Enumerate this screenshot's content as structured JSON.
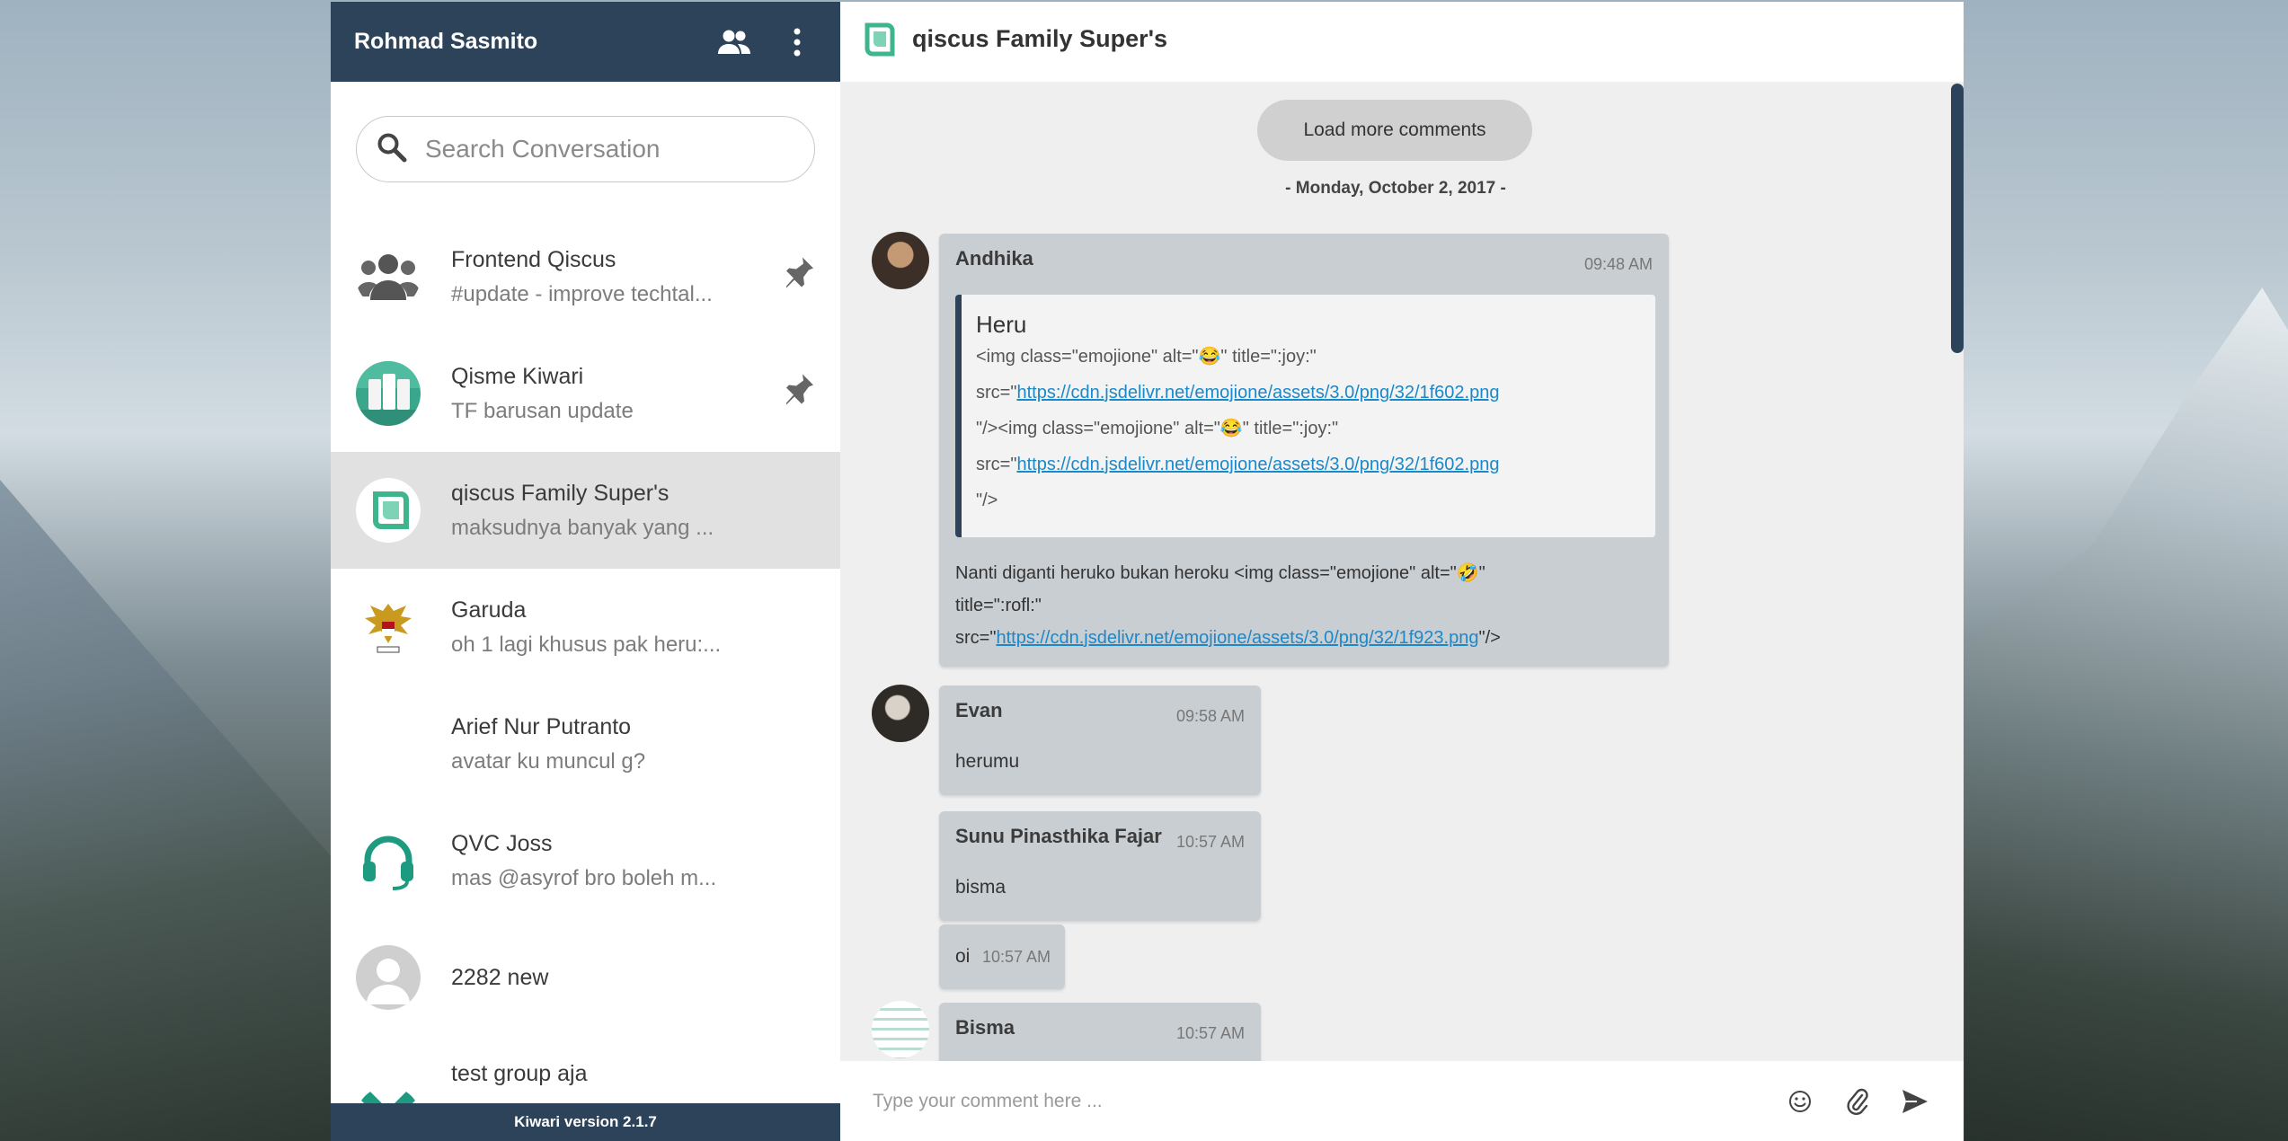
{
  "app": {
    "version": "Kiwari version 2.1.7"
  },
  "sidebar": {
    "user_name": "Rohmad Sasmito",
    "search_placeholder": "Search Conversation",
    "conversations": [
      {
        "name": "Frontend Qiscus",
        "last": "#update - improve techtal...",
        "pinned": true,
        "avatar": "group-icon"
      },
      {
        "name": "Qisme Kiwari",
        "last": "TF barusan update",
        "pinned": true,
        "avatar": "app-screens-avatar"
      },
      {
        "name": "qiscus Family Super's",
        "last": "maksudnya banyak yang ...",
        "pinned": false,
        "active": true,
        "avatar": "qiscus-logo"
      },
      {
        "name": "Garuda",
        "last": "oh 1 lagi khusus pak heru:...",
        "pinned": false,
        "avatar": "garuda-emblem"
      },
      {
        "name": "Arief Nur Putranto",
        "last": "avatar ku muncul g?",
        "pinned": false,
        "avatar": "none"
      },
      {
        "name": "QVC Joss",
        "last": "mas @asyrof bro boleh m...",
        "pinned": false,
        "avatar": "headset-icon"
      },
      {
        "name": "2282 new",
        "last": "",
        "pinned": false,
        "avatar": "default-person-icon"
      },
      {
        "name": "test group aja",
        "last": "",
        "pinned": false,
        "avatar": "x-logo"
      }
    ]
  },
  "chat": {
    "title": "qiscus Family Super's",
    "load_more": "Load more comments",
    "date_divider": "- Monday, October 2, 2017 -",
    "messages": [
      {
        "sender": "Andhika",
        "time": "09:48 AM",
        "quote": {
          "name": "Heru",
          "line1": "<img class=\"emojione\" alt=\"😂\" title=\":joy:\"",
          "line2_prefix": "src=\"",
          "line2_link": "https://cdn.jsdelivr.net/emojione/assets/3.0/png/32/1f602.png",
          "line3": "\"/><img class=\"emojione\" alt=\"😂\" title=\":joy:\"",
          "line4_prefix": "src=\"",
          "line4_link": "https://cdn.jsdelivr.net/emojione/assets/3.0/png/32/1f602.png",
          "line5": "\"/>"
        },
        "body_line1": "Nanti diganti heruko bukan heroku <img class=\"emojione\" alt=\"🤣\"",
        "body_line2": "title=\":rofl:\"",
        "body_line3_prefix": "src=\"",
        "body_line3_link": "https://cdn.jsdelivr.net/emojione/assets/3.0/png/32/1f923.png",
        "body_line3_suffix": "\"/>"
      },
      {
        "sender": "Evan",
        "time": "09:58 AM",
        "text": "herumu"
      },
      {
        "sender": "Sunu Pinasthika Fajar",
        "time": "10:57 AM",
        "text": "bisma"
      },
      {
        "sender": "",
        "time": "10:57 AM",
        "text": "oi"
      },
      {
        "sender": "Bisma",
        "time": "10:57 AM",
        "text": ""
      }
    ],
    "composer_placeholder": "Type your comment here ..."
  },
  "colors": {
    "header": "#2d4359",
    "active_row": "#e1e1e1",
    "bubble": "#c9ced2",
    "link": "#1b88c9"
  }
}
